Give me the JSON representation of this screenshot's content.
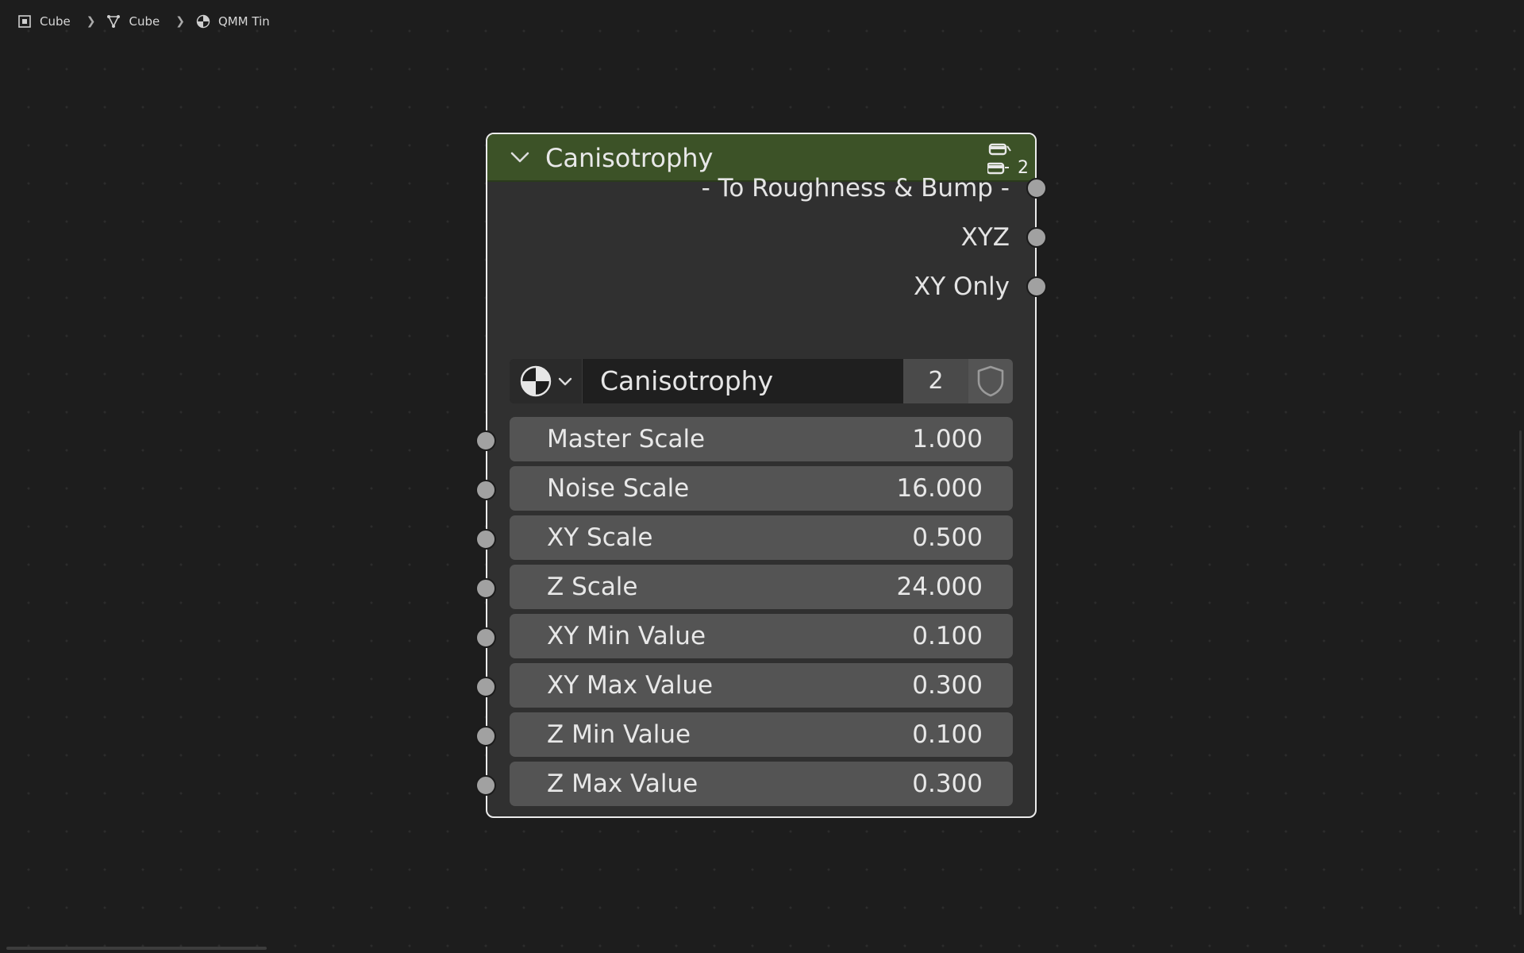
{
  "breadcrumb": {
    "items": [
      {
        "label": "Cube",
        "icon": "object-icon"
      },
      {
        "label": "Cube",
        "icon": "mesh-data-icon"
      },
      {
        "label": "QMM Tin",
        "icon": "material-icon"
      }
    ]
  },
  "node": {
    "title": "Canisotrophy",
    "header_color": "#3c5227",
    "group_users": "2",
    "outputs": [
      {
        "label": "- To Roughness & Bump -"
      },
      {
        "label": "XYZ"
      },
      {
        "label": "XY Only"
      }
    ],
    "datablock": {
      "name": "Canisotrophy",
      "users": "2"
    },
    "inputs": [
      {
        "label": "Master Scale",
        "value": "1.000"
      },
      {
        "label": "Noise Scale",
        "value": "16.000"
      },
      {
        "label": "XY Scale",
        "value": "0.500"
      },
      {
        "label": "Z Scale",
        "value": "24.000"
      },
      {
        "label": "XY Min Value",
        "value": "0.100"
      },
      {
        "label": "XY Max Value",
        "value": "0.300"
      },
      {
        "label": "Z Min Value",
        "value": "0.100"
      },
      {
        "label": "Z Max Value",
        "value": "0.300"
      }
    ]
  }
}
